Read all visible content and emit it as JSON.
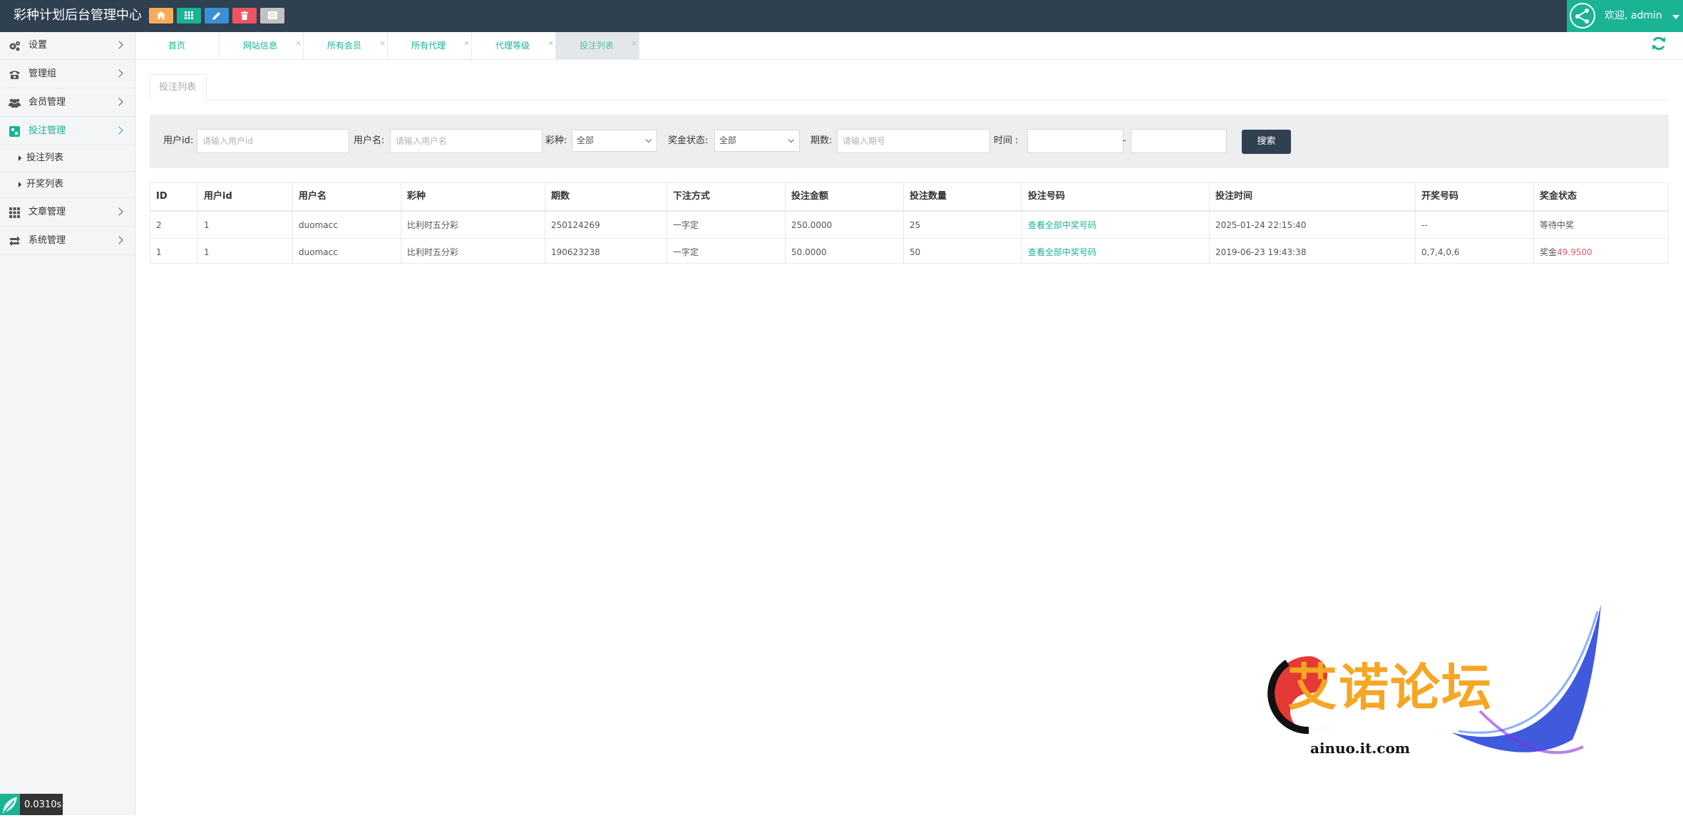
{
  "app": {
    "title": "彩种计划后台管理中心",
    "welcome": "欢迎, admin",
    "colors": {
      "header": "#2f4050",
      "accent": "#1ab394",
      "danger": "#ed5565"
    }
  },
  "quick_buttons": [
    {
      "icon": "home-icon",
      "color": "#f8ac59"
    },
    {
      "icon": "grid-icon",
      "color": "#1ab394"
    },
    {
      "icon": "pencil-icon",
      "color": "#3a8fd6"
    },
    {
      "icon": "trash-icon",
      "color": "#ed5565"
    },
    {
      "icon": "list-icon",
      "color": "#c2c2c2"
    }
  ],
  "sidebar": {
    "items": [
      {
        "label": "设置",
        "icon": "gears-icon"
      },
      {
        "label": "管理组",
        "icon": "phone-icon"
      },
      {
        "label": "会员管理",
        "icon": "users-icon"
      },
      {
        "label": "投注管理",
        "icon": "dashboard-icon",
        "active": true
      },
      {
        "label": "文章管理",
        "icon": "grid-icon"
      },
      {
        "label": "系统管理",
        "icon": "exchange-icon"
      }
    ],
    "subitems": [
      {
        "label": "投注列表"
      },
      {
        "label": "开奖列表"
      }
    ]
  },
  "tabs": [
    {
      "label": "首页"
    },
    {
      "label": "网站信息"
    },
    {
      "label": "所有会员"
    },
    {
      "label": "所有代理"
    },
    {
      "label": "代理等级"
    },
    {
      "label": "投注列表",
      "active": true
    }
  ],
  "panel": {
    "tab_label": "投注列表"
  },
  "search": {
    "userid_label": "用户id:",
    "userid_placeholder": "请输入用户id",
    "username_label": "用户名:",
    "username_placeholder": "请输入用户名",
    "lottery_label": "彩种:",
    "lottery_value": "全部",
    "prize_label": "奖金状态:",
    "prize_value": "全部",
    "period_label": "期数:",
    "period_placeholder": "请输入期号",
    "time_label": "时间 :",
    "time_sep": "-",
    "button": "搜索"
  },
  "table": {
    "headers": [
      "ID",
      "用户id",
      "用户名",
      "彩种",
      "期数",
      "下注方式",
      "投注金额",
      "投注数量",
      "投注号码",
      "投注时间",
      "开奖号码",
      "奖金状态"
    ],
    "rows": [
      {
        "id": "2",
        "user_id": "1",
        "username": "duomacc",
        "lottery": "比利时五分彩",
        "period": "250124269",
        "method": "一字定",
        "amount": "250.0000",
        "count": "25",
        "numbers_link": "查看全部中奖号码",
        "time": "2025-01-24 22:15:40",
        "draw": "--",
        "status": "等待中奖",
        "status_amount": ""
      },
      {
        "id": "1",
        "user_id": "1",
        "username": "duomacc",
        "lottery": "比利时五分彩",
        "period": "190623238",
        "method": "一字定",
        "amount": "50.0000",
        "count": "50",
        "numbers_link": "查看全部中奖号码",
        "time": "2019-06-23 19:43:38",
        "draw": "0,7,4,0,6",
        "status": "奖金",
        "status_amount": "49.9500"
      }
    ]
  },
  "timer": {
    "value": "0.0310s"
  },
  "watermark": {
    "title": "艾诺论坛",
    "url": "ainuo.it.com"
  }
}
